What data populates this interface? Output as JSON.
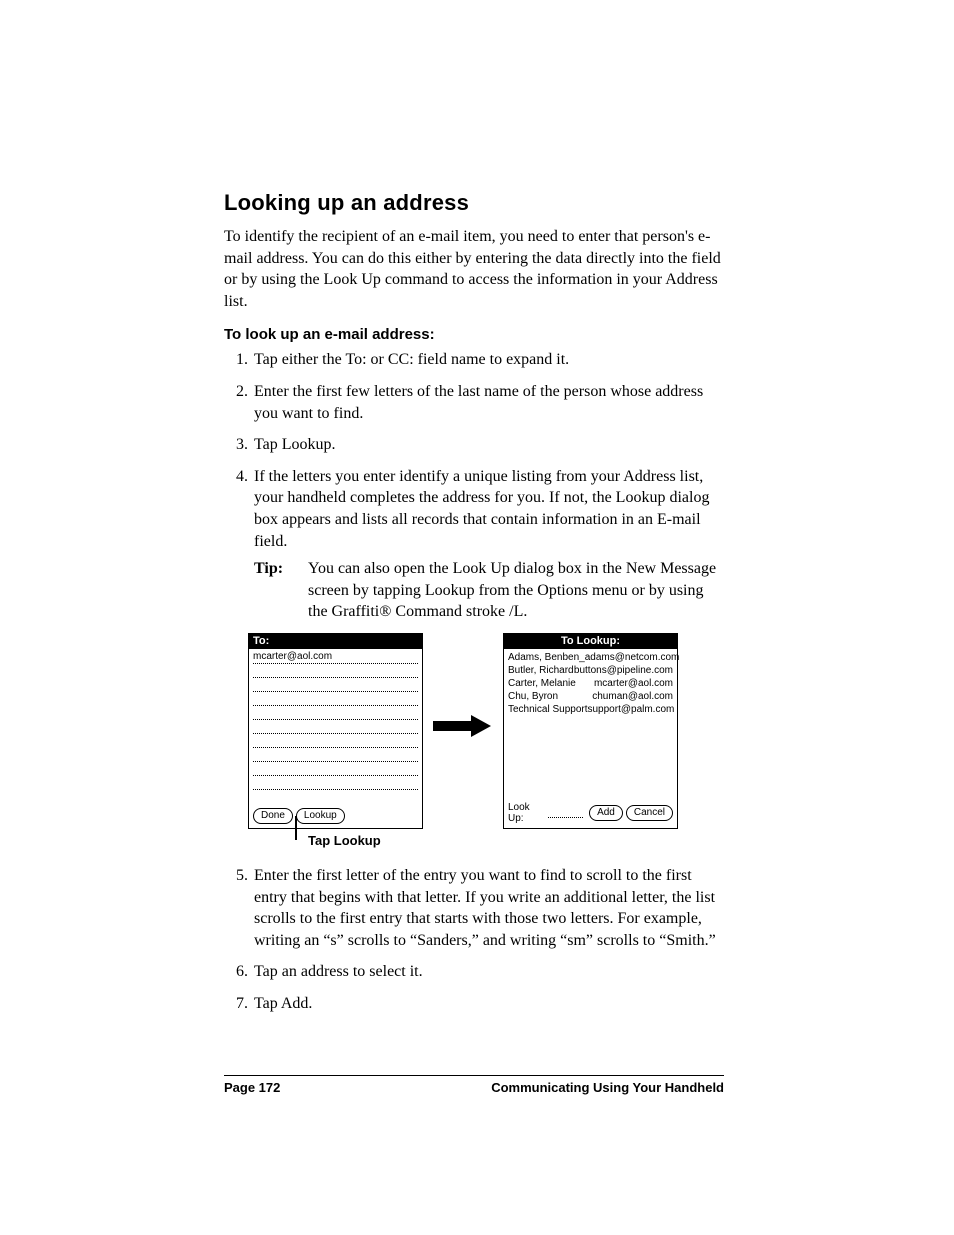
{
  "heading": "Looking up an address",
  "intro": "To identify the recipient of an e-mail item, you need to enter that person's e-mail address. You can do this either by entering the data directly into the field or by using the Look Up command to access the information in your Address list.",
  "subhead": "To look up an e-mail address:",
  "steps_a": [
    "Tap either the To: or CC: field name to expand it.",
    "Enter the first few letters of the last name of the person whose address you want to find.",
    "Tap Lookup.",
    "If the letters you enter identify a unique listing from your Address list, your handheld completes the address for you. If not, the Lookup dialog box appears and lists all records that contain information in an E-mail field."
  ],
  "tip": {
    "label": "Tip:",
    "body": "You can also open the Look Up dialog box in the New Message screen by tapping Lookup from the Options menu or by using the Graffiti® Command stroke /L."
  },
  "figure": {
    "left": {
      "title": "To:",
      "value": "mcarter@aol.com",
      "blank_lines": 9,
      "buttons": {
        "done": "Done",
        "lookup": "Lookup"
      }
    },
    "right": {
      "title": "To Lookup:",
      "contacts": [
        {
          "name": "Adams, Ben",
          "email": "ben_adams@netcom.com"
        },
        {
          "name": "Butler, Richard",
          "email": "buttons@pipeline.com"
        },
        {
          "name": "Carter, Melanie",
          "email": "mcarter@aol.com"
        },
        {
          "name": "Chu, Byron",
          "email": "chuman@aol.com"
        },
        {
          "name": "Technical Support",
          "email": "support@palm.com"
        }
      ],
      "lookup_label": "Look Up:",
      "buttons": {
        "add": "Add",
        "cancel": "Cancel"
      }
    },
    "callout": "Tap Lookup"
  },
  "steps_b": [
    "Enter the first letter of the entry you want to find to scroll to the first entry that begins with that letter. If you write an additional letter, the list scrolls to the first entry that starts with those two letters. For example, writing an “s” scrolls to “Sanders,” and writing “sm” scrolls to “Smith.”",
    "Tap an address to select it.",
    "Tap Add."
  ],
  "footer": {
    "left": "Page 172",
    "right": "Communicating Using Your Handheld"
  }
}
